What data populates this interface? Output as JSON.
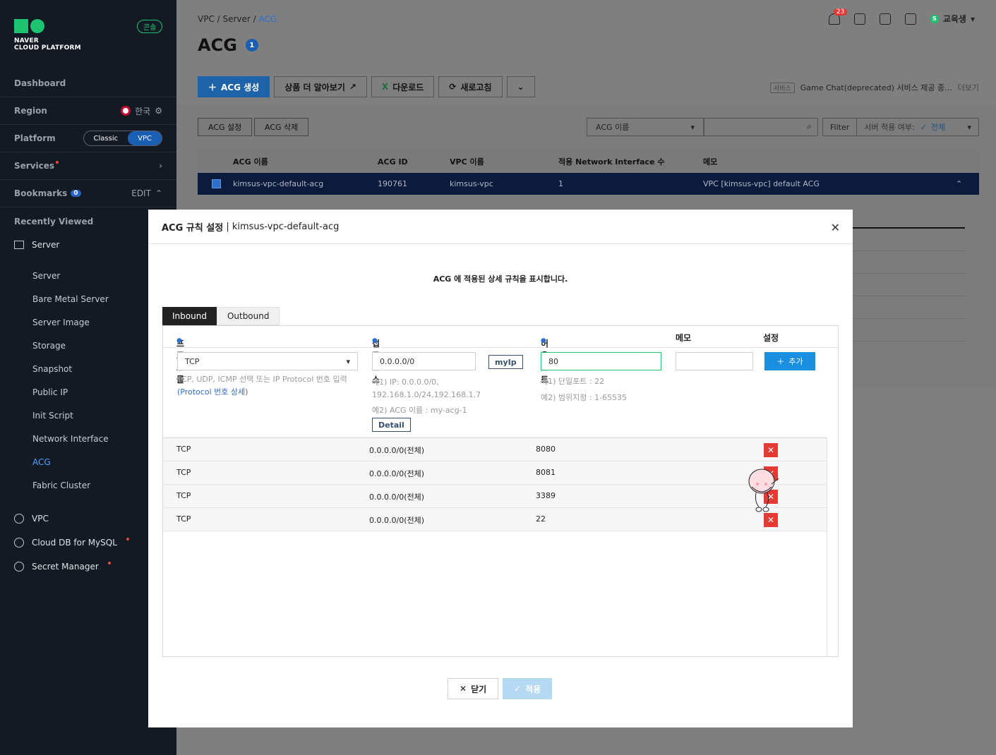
{
  "sidebar": {
    "logo_line1": "NAVER",
    "logo_line2": "CLOUD PLATFORM",
    "console_badge": "콘솔",
    "dashboard": "Dashboard",
    "region_label": "Region",
    "region_value": "한국",
    "platform_label": "Platform",
    "platform_options": [
      "Classic",
      "VPC"
    ],
    "platform_selected": "VPC",
    "services_label": "Services",
    "bookmarks_label": "Bookmarks",
    "bookmarks_count": "0",
    "bookmarks_edit": "EDIT",
    "recently_viewed": "Recently Viewed",
    "server_group": "Server",
    "server_items": [
      "Server",
      "Bare Metal Server",
      "Server Image",
      "Storage",
      "Snapshot",
      "Public IP",
      "Init Script",
      "Network Interface",
      "ACG",
      "Fabric Cluster"
    ],
    "active_item": "ACG",
    "services": [
      "VPC",
      "Cloud DB for MySQL",
      "Secret Manager"
    ]
  },
  "header": {
    "breadcrumb": [
      "VPC",
      "Server",
      "ACG"
    ],
    "title": "ACG",
    "title_badge": "1",
    "notification_count": "23",
    "user_initial": "S",
    "user_name": "교육생"
  },
  "toolbar": {
    "create": "ACG 생성",
    "learn_more": "상품 더 알아보기",
    "download": "다운로드",
    "refresh": "새로고침",
    "notice_tag": "서비스",
    "notice_text": "Game Chat(deprecated) 서비스 제공 종...",
    "notice_more": "더보기"
  },
  "list_controls": {
    "acg_settings": "ACG 설정",
    "acg_delete": "ACG 삭제",
    "search_field": "ACG 이름",
    "filter_label": "Filter",
    "filter_name": "서버 적용 여부:",
    "filter_value": "전체"
  },
  "acg_table": {
    "columns": [
      "ACG 이름",
      "ACG ID",
      "VPC 이름",
      "적용 Network Interface 수",
      "메모"
    ],
    "rows": [
      {
        "name": "kimsus-vpc-default-acg",
        "id": "190761",
        "vpc": "kimsus-vpc",
        "ni_count": "1",
        "memo": "VPC [kimsus-vpc] default ACG"
      }
    ]
  },
  "modal": {
    "title_bold": "ACG 규칙 설정",
    "title_sub": "| kimsus-vpc-default-acg",
    "description": "ACG 에 적용된 상세 규칙을 표시합니다.",
    "tabs": [
      "Inbound",
      "Outbound"
    ],
    "active_tab": "Inbound",
    "columns": {
      "protocol": "프로토콜",
      "source": "접근 소스",
      "port": "허용 포트",
      "memo": "메모",
      "setting": "설정"
    },
    "form": {
      "protocol_value": "TCP",
      "protocol_hint1": "TCP, UDP, ICMP 선택 또는 IP Protocol 번호 입력",
      "protocol_hint_link": "(Protocol 번호 상세)",
      "source_value": "0.0.0.0/0",
      "myip_button": "myIp",
      "source_hint1": "예1) IP: 0.0.0.0/0,",
      "source_hint2": "192.168.1.0/24,192.168.1.7",
      "source_hint3": "예2) ACG 이름 : my-acg-1",
      "detail_button": "Detail",
      "port_value": "80",
      "port_hint1": "예1) 단일포트 : 22",
      "port_hint2": "예2) 범위지정 : 1-65535",
      "memo_value": "",
      "add_button": "추가"
    },
    "rules": [
      {
        "protocol": "TCP",
        "source": "0.0.0.0/0(전체)",
        "port": "8080"
      },
      {
        "protocol": "TCP",
        "source": "0.0.0.0/0(전체)",
        "port": "8081"
      },
      {
        "protocol": "TCP",
        "source": "0.0.0.0/0(전체)",
        "port": "3389"
      },
      {
        "protocol": "TCP",
        "source": "0.0.0.0/0(전체)",
        "port": "22"
      }
    ],
    "close_button": "닫기",
    "apply_button": "적용"
  },
  "colors": {
    "sidebar_bg": "#141a23",
    "accent_green": "#1ec36f",
    "primary_blue": "#1e62a8",
    "add_blue": "#1a8fe0",
    "delete_red": "#e53935",
    "selected_row": "#0c1b3b"
  }
}
